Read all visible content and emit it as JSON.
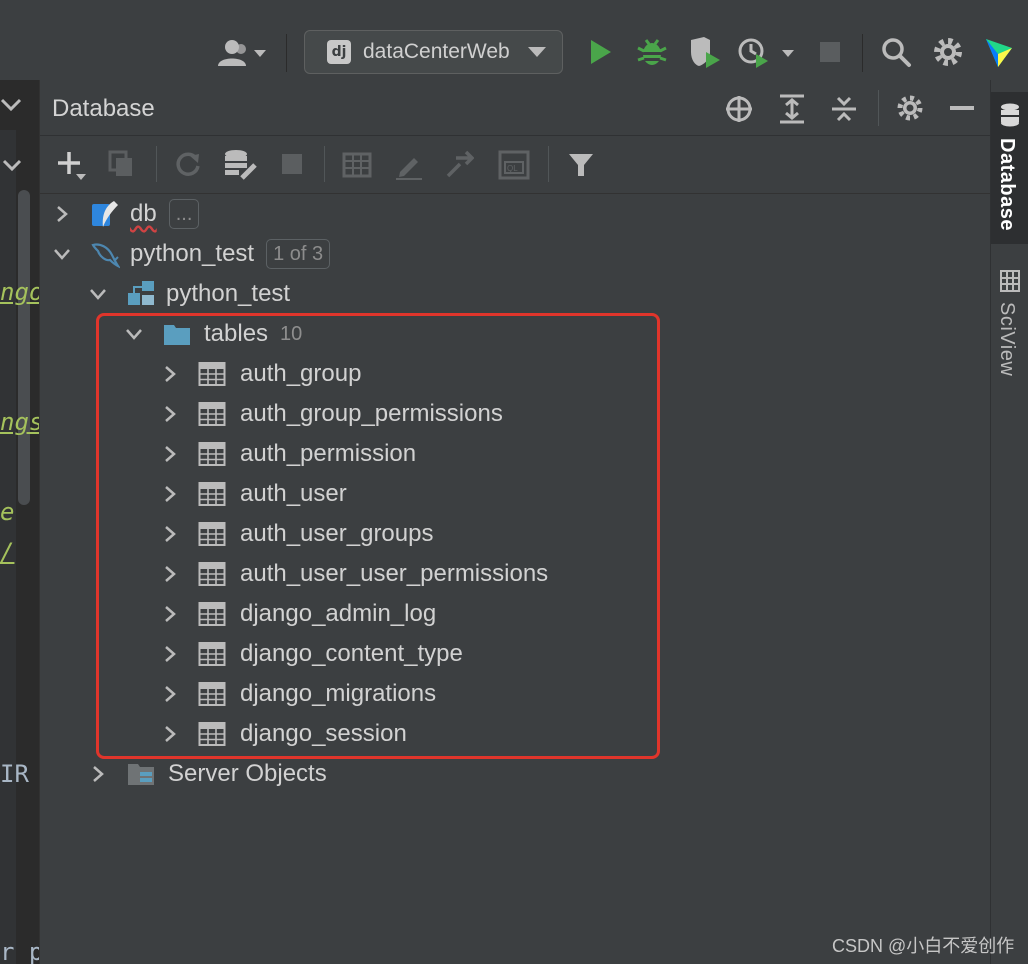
{
  "toolbar": {
    "run_config": "dataCenterWeb",
    "run_config_badge": "dj"
  },
  "editor": {
    "fragments": [
      "ngo",
      "ngs",
      "e",
      "/",
      "IR",
      "r p"
    ]
  },
  "database": {
    "title": "Database",
    "tree": {
      "db": {
        "label": "db",
        "badge": "..."
      },
      "connection": {
        "label": "python_test",
        "badge": "1 of 3"
      },
      "schema": {
        "label": "python_test"
      },
      "tables": {
        "label": "tables",
        "count": "10",
        "items": [
          "auth_group",
          "auth_group_permissions",
          "auth_permission",
          "auth_user",
          "auth_user_groups",
          "auth_user_user_permissions",
          "django_admin_log",
          "django_content_type",
          "django_migrations",
          "django_session"
        ]
      },
      "server_objects": {
        "label": "Server Objects"
      }
    }
  },
  "side_tabs": {
    "database": "Database",
    "sciview": "SciView"
  },
  "watermark": "CSDN @小白不爱创作",
  "colors": {
    "background": "#3c3f41",
    "editor": "#2b2b2b",
    "highlight": "#e0352b",
    "run": "#4aa54a",
    "folder": "#5a9ebf"
  }
}
